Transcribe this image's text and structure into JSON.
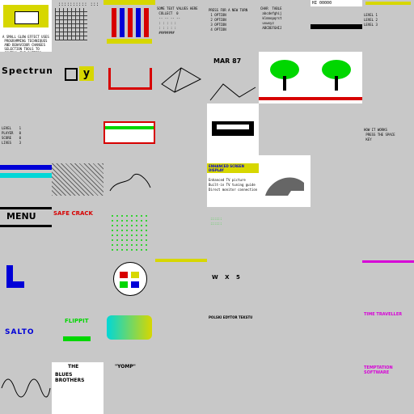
{
  "colors": {
    "bg": "#c8c8c8",
    "yellow": "#d7d700",
    "blue": "#0000d7",
    "red": "#d70000",
    "green": "#00d700",
    "cyan": "#00d7d7",
    "magenta": "#d700d7",
    "white": "#ffffff",
    "black": "#000000"
  },
  "labels": {
    "spectrum_sprites": "Spectrum sprites!",
    "menu": "MENU",
    "safe_crack": "SAFE CRACK",
    "flippit": "FLIPPIT",
    "salto": "SALTO",
    "blues_brothers_the": "THE",
    "blues_brothers": "BLUES BROTHERS",
    "yomp": "\"YOMP\"",
    "time_traveller": "TIME TRAVELLER",
    "temptation": "TEMPTATION SOFTWARE",
    "polski": "POLSKI EDYTOR TEKSTU",
    "wx5": "W X 5",
    "enhanced": "ENHANCED SCREEN DISPLAY",
    "enh1": "Enhanced TV picture",
    "enh2": "Built-in TV tuning guide",
    "enh3": "Direct monitor connection",
    "firestarter": "FIRESTARTER OPT'S",
    "mar": "MAR 87",
    "sequence": "SEQUENCE:"
  }
}
